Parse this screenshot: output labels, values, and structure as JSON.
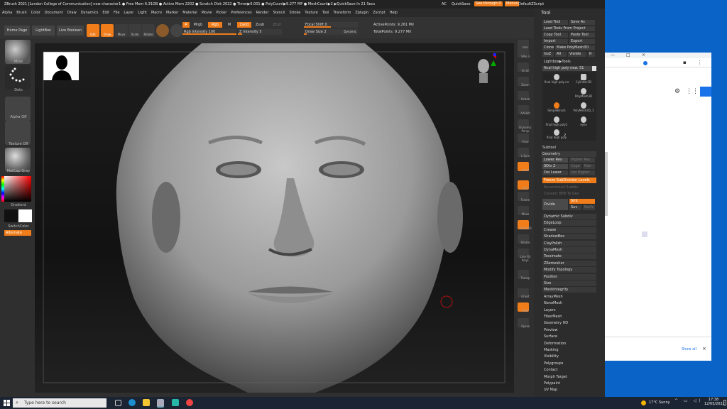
{
  "titlebar": {
    "title": "ZBrush 2021 [London College of Communication]   new character1  ● Free Mem 6.31GB ● Active Mem 2202 ● Scratch Disk 2022 ● Timer▶0.001 ● PolyCount▶9.277 MP ● MeshCount▶2 ▶QuickSave In 21 Secs",
    "ac": "AC",
    "quicksave": "QuickSave",
    "seethrough": "See-through  0",
    "menus": "Menus",
    "script": "DefaultZScript"
  },
  "menubar": [
    "Alpha",
    "Brush",
    "Color",
    "Document",
    "Draw",
    "Dynamics",
    "Edit",
    "File",
    "Layer",
    "Light",
    "Macro",
    "Marker",
    "Material",
    "Movie",
    "Picker",
    "Preferences",
    "Render",
    "Stencil",
    "Stroke",
    "Texture",
    "Tool",
    "Transform",
    "Zplugin",
    "Zscript",
    "Help"
  ],
  "toolbar": {
    "home": "Home Page",
    "lightbox": "LightBox",
    "livebool": "Live Boolean",
    "edit": "Edit",
    "draw": "Draw",
    "move": "Move",
    "scale": "Scale",
    "rotate": "Rotate",
    "a": "A",
    "mrgb": "Mrgb",
    "rgb": "Rgb",
    "m": "M",
    "zadd": "Zadd",
    "zsub": "Zsub",
    "zcut": "Zcut",
    "rgb_int": "Rgb Intensity 100",
    "z_int": "Z Intensity 5",
    "focal": "Focal Shift 0",
    "drawsize": "Draw Size 2",
    "dynamic": "Dynamic",
    "active_points": "ActivePoints: 9.261 Mil",
    "total_points": "TotalPoints: 9.277 Mil"
  },
  "left_shelf": {
    "mrse": "Mrse",
    "dots": "Dots",
    "alpha_off": "Alpha Off",
    "texture_off": "Texture Off",
    "matcap": "MatCap Gray",
    "gradient": "Gradient",
    "switchcolor": "SwitchColor",
    "alternate": "Alternate"
  },
  "right_shelf": [
    "BPR",
    "SPix 3",
    "Scroll",
    "Zoom",
    "Actual",
    "AAHalf",
    "Dynamic Persp",
    "Floor",
    "L.Sym",
    "Local",
    "XYZ",
    "Frame",
    "Move",
    "Zoom3D",
    "Rotate",
    "Line Fill PolyF",
    "Transp",
    "Ghost",
    "Solo",
    "Xpose"
  ],
  "tool_panel": {
    "title": "Tool",
    "load": "Load Tool",
    "saveas": "Save As",
    "loadproject": "Load Tools From Project",
    "copy": "Copy Tool",
    "paste": "Paste Tool",
    "import": "Import",
    "export": "Export",
    "clone": "Clone",
    "makepoly": "Make PolyMesh3D",
    "goz": "GoZ",
    "all": "All",
    "visible": "Visible",
    "r": "R",
    "lightbox_tools": "Lightbox▶Tools",
    "current_tool": "final high poly new. 51",
    "thumbs": [
      "final high poly ne",
      "Cylinder3D",
      "PolyMesh3D",
      "SimpleBrush",
      "PolyMesh3D_1",
      "final high poly1",
      "eyes",
      "final high poly"
    ],
    "thumb_count": "2",
    "subtool": "Subtool",
    "geometry": "Geometry",
    "lower_res": "Lower Res",
    "higher_res": "Higher Res",
    "sdiv": "SDiv 2",
    "cage": "Cage",
    "rstr": "Rstr",
    "del_lower": "Del Lower",
    "del_higher": "Del Higher",
    "freeze": "Freeze SubDivision Levels",
    "reconstruct": "Reconstruct Subdiv",
    "convert_bpr": "Convert BPR To Geo",
    "divide": "Divide",
    "smt": "Smt",
    "suv": "Suv",
    "reuv": "ReUV",
    "sections": [
      "Dynamic Subdiv",
      "EdgeLoop",
      "Crease",
      "ShadowBox",
      "ClayPolish",
      "DynaMesh",
      "Tessimate",
      "ZRemesher",
      "Modify Topology",
      "Position",
      "Size",
      "MeshIntegrity",
      "ArrayMesh",
      "NanoMesh",
      "Layers",
      "FiberMesh",
      "Geometry HD",
      "Preview",
      "Surface",
      "Deformation",
      "Masking",
      "Visibility",
      "Polygroups",
      "Contact",
      "Morph Target",
      "Polypaint",
      "UV Map"
    ]
  },
  "browser": {
    "show_all": "Show all",
    "close": "×"
  },
  "taskbar": {
    "search": "Type here to search",
    "weather": "17°C  Sunny",
    "time": "17:38",
    "date": "12/05/2022"
  },
  "colors": {
    "accent": "#f07c1a",
    "desktop": "#0a64c8",
    "taskbar": "#1b2433"
  }
}
